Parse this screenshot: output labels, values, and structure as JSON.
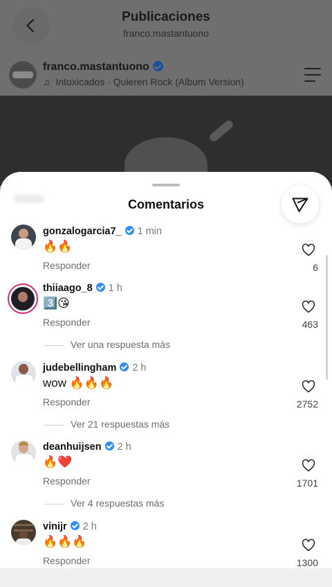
{
  "header": {
    "title": "Publicaciones",
    "subtitle": "franco.mastantuono"
  },
  "post": {
    "username": "franco.mastantuono",
    "song": "Intoxicados · Quieren Rock (Album Version)"
  },
  "comments_sheet": {
    "title": "Comentarios",
    "comments": [
      {
        "user": "gonzalogarcia7_",
        "time": "1 min",
        "text": "🔥🔥",
        "reply": "Responder",
        "likes": "6",
        "more": ""
      },
      {
        "user": "thiiaago_8",
        "time": "1 h",
        "text": "3️⃣😘",
        "reply": "Responder",
        "likes": "463",
        "more": "Ver una respuesta más"
      },
      {
        "user": "judebellingham",
        "time": "2 h",
        "text": "wow 🔥🔥🔥",
        "reply": "Responder",
        "likes": "2752",
        "more": "Ver 21 respuestas más"
      },
      {
        "user": "deanhuijsen",
        "time": "2 h",
        "text": "🔥❤️",
        "reply": "Responder",
        "likes": "1701",
        "more": "Ver 4 respuestas más"
      },
      {
        "user": "vinijr",
        "time": "2 h",
        "text": "🔥🔥🔥",
        "reply": "Responder",
        "likes": "1300",
        "more": ""
      }
    ]
  },
  "icons": {
    "back": "chevron-left-icon",
    "menu": "menu-icon",
    "filter": "filter-icon",
    "like": "heart-icon",
    "verified": "verified-badge-icon",
    "music": "music-note-icon"
  },
  "colors": {
    "verified": "#2f8ef4",
    "story_ring": "#d62976"
  }
}
